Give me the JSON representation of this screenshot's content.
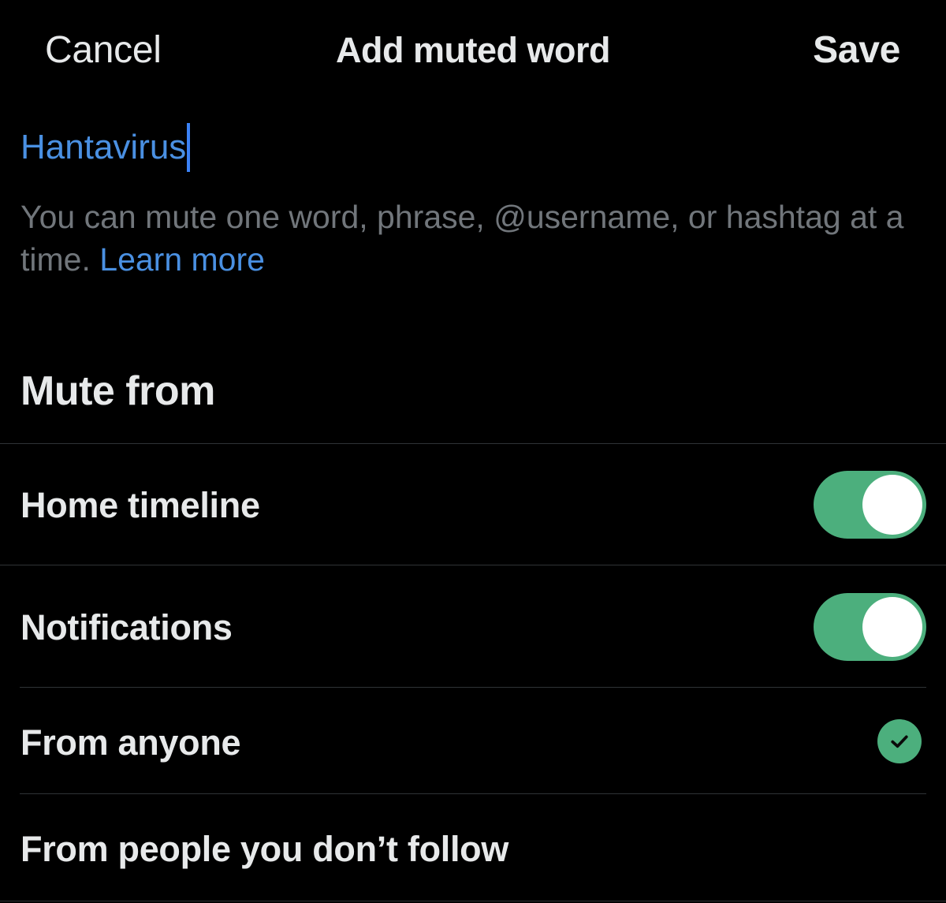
{
  "header": {
    "cancel_label": "Cancel",
    "title": "Add muted word",
    "save_label": "Save"
  },
  "input": {
    "value": "Hantavirus"
  },
  "helper": {
    "text": "You can mute one word, phrase, @username, or hashtag at a time.",
    "link_label": "Learn more"
  },
  "mute_from": {
    "title": "Mute from",
    "options": [
      {
        "label": "Home timeline",
        "toggle_on": true
      },
      {
        "label": "Notifications",
        "toggle_on": true
      }
    ]
  },
  "audience": {
    "options": [
      {
        "label": "From anyone",
        "selected": true
      },
      {
        "label": "From people you don’t follow",
        "selected": false
      }
    ]
  },
  "colors": {
    "background": "#000000",
    "text": "#e7e9ea",
    "secondary_text": "#71767b",
    "link": "#4a90e2",
    "accent_green": "#4caf7d",
    "divider": "#2f3336"
  }
}
